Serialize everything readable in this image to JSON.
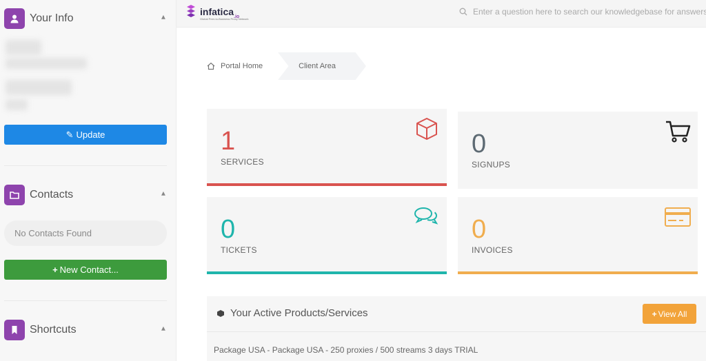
{
  "sidebar": {
    "your_info": {
      "title": "Your Info",
      "button": "Update"
    },
    "contacts": {
      "title": "Contacts",
      "empty": "No Contacts Found",
      "button": "New Contact..."
    },
    "shortcuts": {
      "title": "Shortcuts"
    }
  },
  "topbar": {
    "logo": "infatica",
    "logo_suffix": ".io",
    "logo_tagline": "Global Peer-to-Business Proxy Network",
    "search_placeholder": "Enter a question here to search our knowledgebase for answers..."
  },
  "breadcrumb": {
    "home": "Portal Home",
    "current": "Client Area"
  },
  "stats": [
    {
      "value": "1",
      "label": "SERVICES",
      "color": "#d9534f",
      "icon": "cube-icon"
    },
    {
      "value": "0",
      "label": "SIGNUPS",
      "color": "#5d6a73",
      "icon": "cart-icon"
    },
    {
      "value": "0",
      "label": "TICKETS",
      "color": "#1fb5ac",
      "icon": "chat-bubbles-icon"
    },
    {
      "value": "0",
      "label": "INVOICES",
      "color": "#f0ad4e",
      "icon": "credit-card-icon"
    }
  ],
  "products": {
    "title": "Your Active Products/Services",
    "view_all": "View All",
    "rows": [
      "Package USA - Package USA - 250 proxies / 500 streams 3 days TRIAL"
    ]
  }
}
